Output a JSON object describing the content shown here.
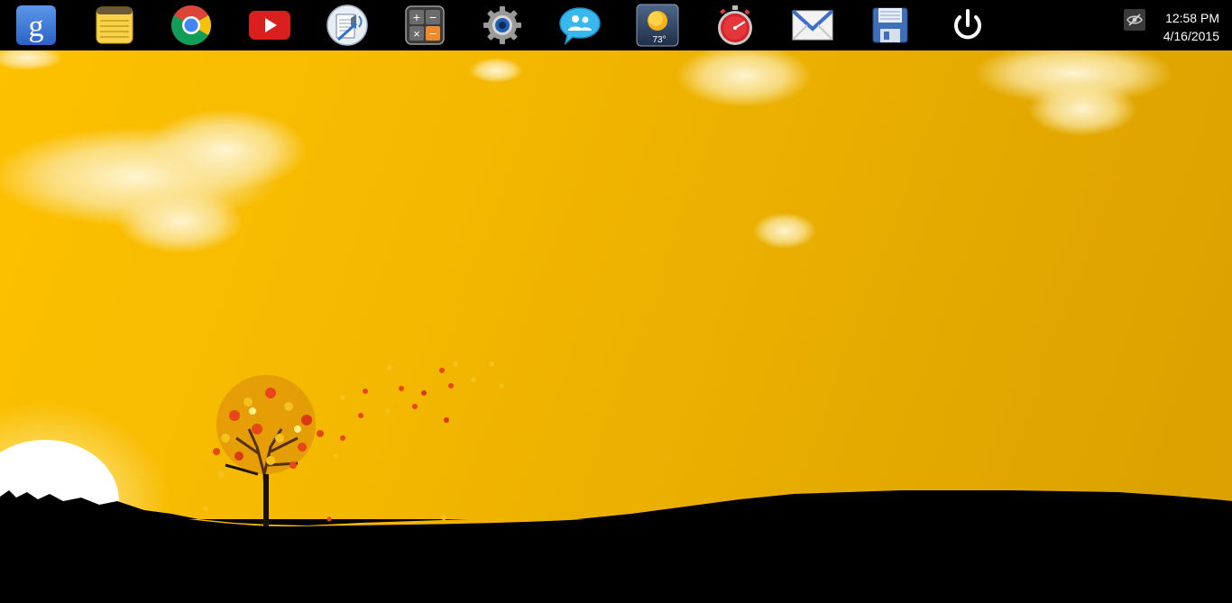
{
  "dock": {
    "icons": [
      {
        "name": "google-search",
        "icon": "google-icon"
      },
      {
        "name": "notes",
        "icon": "notepad-icon"
      },
      {
        "name": "chrome",
        "icon": "chrome-icon"
      },
      {
        "name": "youtube",
        "icon": "youtube-icon"
      },
      {
        "name": "reader",
        "icon": "speaker-document-icon"
      },
      {
        "name": "calculator",
        "icon": "calculator-icon"
      },
      {
        "name": "settings",
        "icon": "gear-icon"
      },
      {
        "name": "messenger",
        "icon": "chat-bubble-icon"
      },
      {
        "name": "weather",
        "icon": "weather-sun-icon",
        "temperature": "73°"
      },
      {
        "name": "stopwatch",
        "icon": "stopwatch-icon"
      },
      {
        "name": "mail",
        "icon": "mail-icon"
      },
      {
        "name": "save",
        "icon": "floppy-disk-icon"
      },
      {
        "name": "power",
        "icon": "power-icon"
      }
    ]
  },
  "tray": {
    "hide_icon": "eye-slash-icon",
    "time": "12:58 PM",
    "date": "4/16/2015"
  },
  "wallpaper": {
    "sky_color": "#f4b800",
    "ground_color": "#000000",
    "sun_color": "#ffffff"
  }
}
